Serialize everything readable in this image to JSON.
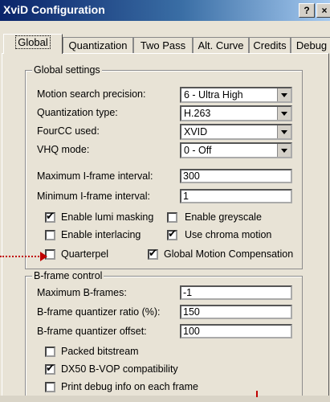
{
  "window": {
    "title": "XviD Configuration",
    "help_label": "?",
    "close_label": "×"
  },
  "tabs": [
    {
      "label": "Global"
    },
    {
      "label": "Quantization"
    },
    {
      "label": "Two Pass"
    },
    {
      "label": "Alt. Curve"
    },
    {
      "label": "Credits"
    },
    {
      "label": "Debug"
    }
  ],
  "global_settings": {
    "title": "Global settings",
    "motion_search_label": "Motion search precision:",
    "motion_search_value": "6 - Ultra High",
    "quant_type_label": "Quantization type:",
    "quant_type_value": "H.263",
    "fourcc_label": "FourCC used:",
    "fourcc_value": "XVID",
    "vhq_label": "VHQ mode:",
    "vhq_value": "0 - Off",
    "max_iframe_label": "Maximum I-frame interval:",
    "max_iframe_value": "300",
    "min_iframe_label": "Minimum I-frame interval:",
    "min_iframe_value": "1",
    "lumi_label": "Enable lumi masking",
    "greyscale_label": "Enable greyscale",
    "interlacing_label": "Enable interlacing",
    "chroma_label": "Use chroma motion",
    "quarterpel_label": "Quarterpel",
    "gmc_label": "Global Motion Compensation"
  },
  "bframe": {
    "title": "B-frame control",
    "max_label": "Maximum B-frames:",
    "max_value": "-1",
    "ratio_label": "B-frame quantizer ratio (%):",
    "ratio_value": "150",
    "offset_label": "B-frame quantizer offset:",
    "offset_value": "100",
    "packed_label": "Packed bitstream",
    "dx50_label": "DX50 B-VOP compatibility",
    "debug_label": "Print debug info on each frame"
  },
  "checkbox_states": {
    "lumi": true,
    "greyscale": false,
    "interlacing": false,
    "chroma": true,
    "quarterpel": false,
    "gmc": true,
    "packed": false,
    "dx50": true,
    "debug": false
  },
  "colors": {
    "annotation": "#c00000",
    "titlebar": "#0a246a"
  }
}
